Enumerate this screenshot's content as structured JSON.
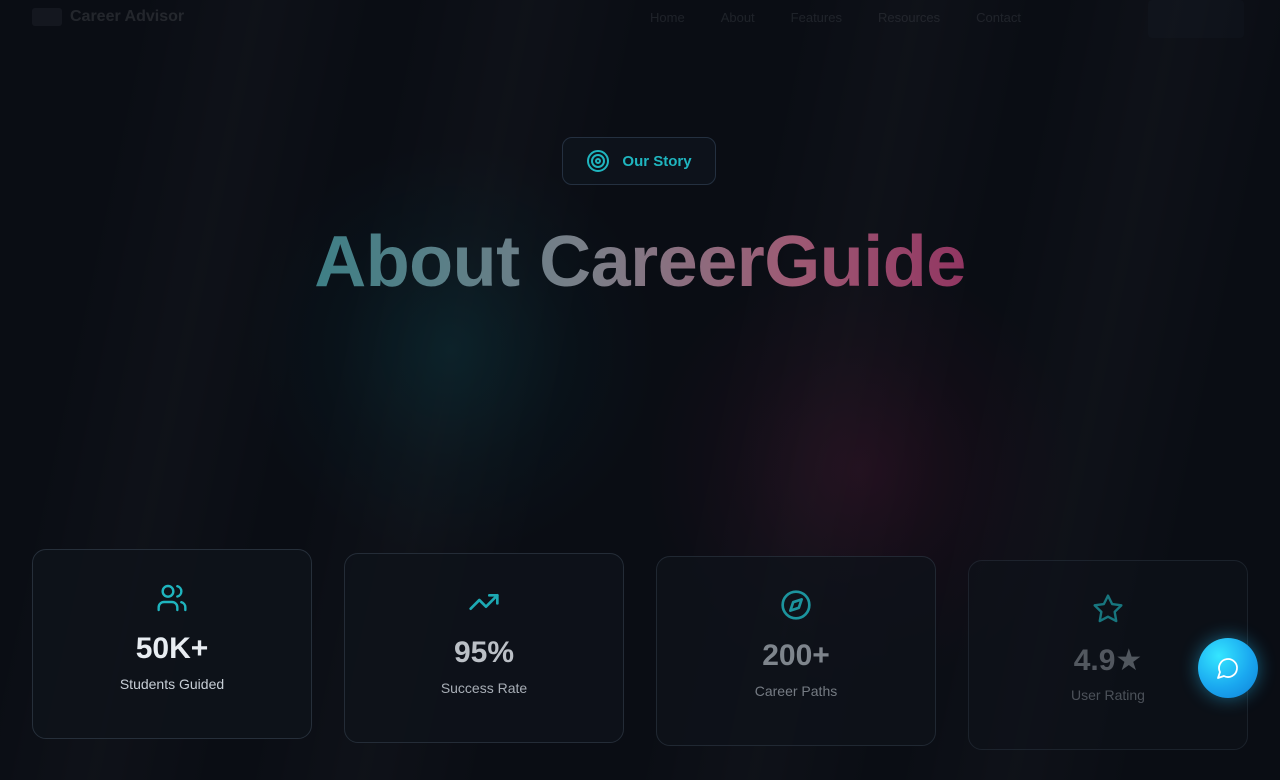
{
  "nav": {
    "brand": "Career Advisor",
    "links": [
      "Home",
      "About",
      "Features",
      "Resources",
      "Contact"
    ]
  },
  "badge": {
    "label": "Our Story",
    "icon": "target-icon"
  },
  "hero": {
    "title": "About CareerGuide"
  },
  "stats": [
    {
      "value": "50K+",
      "label": "Students Guided",
      "icon": "users-icon"
    },
    {
      "value": "95%",
      "label": "Success Rate",
      "icon": "trending-up-icon"
    },
    {
      "value": "200+",
      "label": "Career Paths",
      "icon": "compass-icon"
    },
    {
      "value": "4.9★",
      "label": "User Rating",
      "icon": "star-icon"
    }
  ],
  "chat": {
    "icon": "chat-bubble-icon"
  },
  "colors": {
    "accent": "#1fb5bf",
    "background": "#0a0d14",
    "title_end": "#7a1a4f",
    "fab": "#1aa8f0"
  }
}
